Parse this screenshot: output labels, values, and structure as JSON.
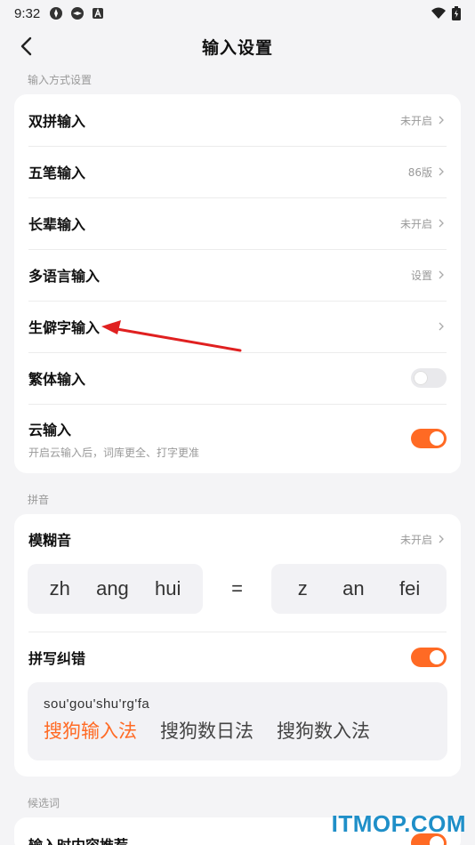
{
  "status": {
    "time": "9:32"
  },
  "header": {
    "title": "输入设置"
  },
  "sections": {
    "input_methods": "输入方式设置",
    "pinyin": "拼音",
    "candidates": "候选词"
  },
  "input_methods": [
    {
      "title": "双拼输入",
      "value": "未开启"
    },
    {
      "title": "五笔输入",
      "value": "86版"
    },
    {
      "title": "长辈输入",
      "value": "未开启"
    },
    {
      "title": "多语言输入",
      "value": "设置"
    },
    {
      "title": "生僻字输入",
      "value": ""
    }
  ],
  "traditional": {
    "title": "繁体输入",
    "on": false
  },
  "cloud": {
    "title": "云输入",
    "subtitle": "开启云输入后，词库更全、打字更准",
    "on": true
  },
  "fuzzy": {
    "title": "模糊音",
    "value": "未开启",
    "left": [
      "zh",
      "ang",
      "hui"
    ],
    "equals": "=",
    "right": [
      "z",
      "an",
      "fei"
    ]
  },
  "spell": {
    "title": "拼写纠错",
    "on": true,
    "input": "sou'gou'shu'rg'fa",
    "candidates": [
      "搜狗输入法",
      "搜狗数日法",
      "搜狗数入法"
    ]
  },
  "recommend": {
    "title": "输入时内容推荐"
  },
  "watermark": "ITMOP.COM",
  "colors": {
    "accent": "#ff6a24",
    "annotation": "#e02020",
    "watermark": "#1f8fc8"
  }
}
